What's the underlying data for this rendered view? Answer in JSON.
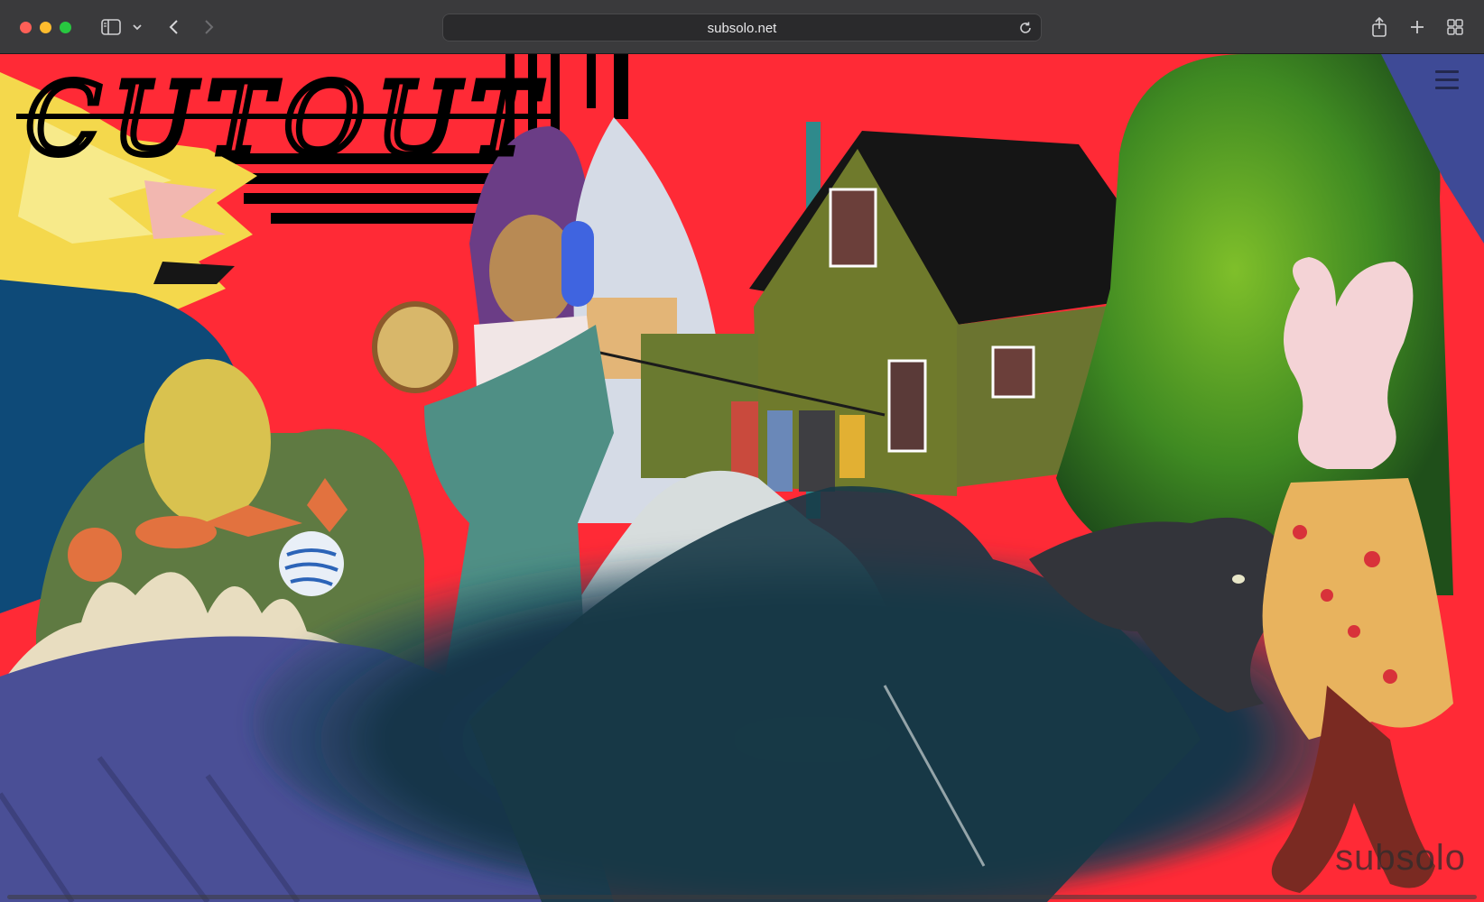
{
  "browser": {
    "url": "subsolo.net",
    "icons": [
      "sidebar-icon",
      "chevron-down-icon",
      "back-icon",
      "forward-icon",
      "reload-icon",
      "share-icon",
      "new-tab-icon",
      "tab-overview-icon"
    ]
  },
  "page": {
    "logo_text": "CUTOUT",
    "brand_text": "subsolo",
    "menu_icon": "hamburger-icon"
  },
  "colors": {
    "background_red": "#ff2a36",
    "toolbar": "#3a3a3c"
  }
}
